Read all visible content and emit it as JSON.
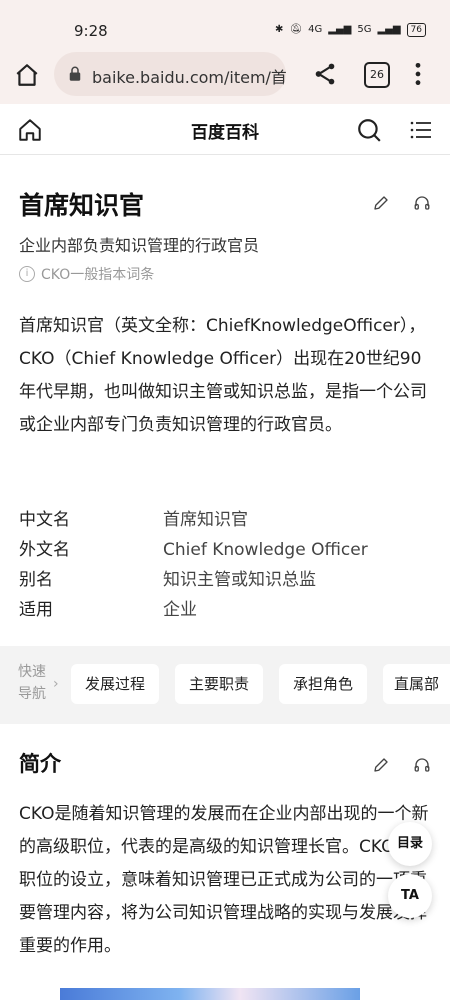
{
  "status_bar": {
    "time": "9:28",
    "network_1": "4G",
    "network_2": "5G",
    "battery": "76"
  },
  "browser": {
    "url": "baike.baidu.com/item/首",
    "tab_count": "26"
  },
  "site_header": {
    "title": "百度百科"
  },
  "entry": {
    "title": "首席知识官",
    "subtitle": "企业内部负责知识管理的行政官员",
    "disambiguation": "CKO一般指本词条",
    "summary": "首席知识官（英文全称：ChiefKnowledgeOfficer），CKO（Chief Knowledge Officer）出现在20世纪90年代早期，也叫做知识主管或知识总监，是指一个公司或企业内部专门负责知识管理的行政官员。"
  },
  "infobox": [
    {
      "key": "中文名",
      "value": "首席知识官"
    },
    {
      "key": "外文名",
      "value": "Chief Knowledge Officer"
    },
    {
      "key": "别名",
      "value": "知识主管或知识总监"
    },
    {
      "key": "适用",
      "value": "企业"
    }
  ],
  "quick_nav": {
    "label": "快速导航",
    "items": [
      "发展过程",
      "主要职责",
      "承担角色",
      "直属部"
    ]
  },
  "intro_section": {
    "title": "简介",
    "text": "CKO是随着知识管理的发展而在企业内部出现的一个新的高级职位，代表的是高级的知识管理长官。CKO这一职位的设立，意味着知识管理已正式成为公司的一项重要管理内容，将为公司知识管理战略的实现与发展发挥重要的作用。"
  },
  "floating": {
    "toc_label": "目录",
    "ta_label": "TA"
  },
  "colors": {
    "accent": "#111111",
    "muted": "#999999",
    "nav_bg": "#f3f3f3",
    "browser_bg": "#f8f0ee"
  }
}
